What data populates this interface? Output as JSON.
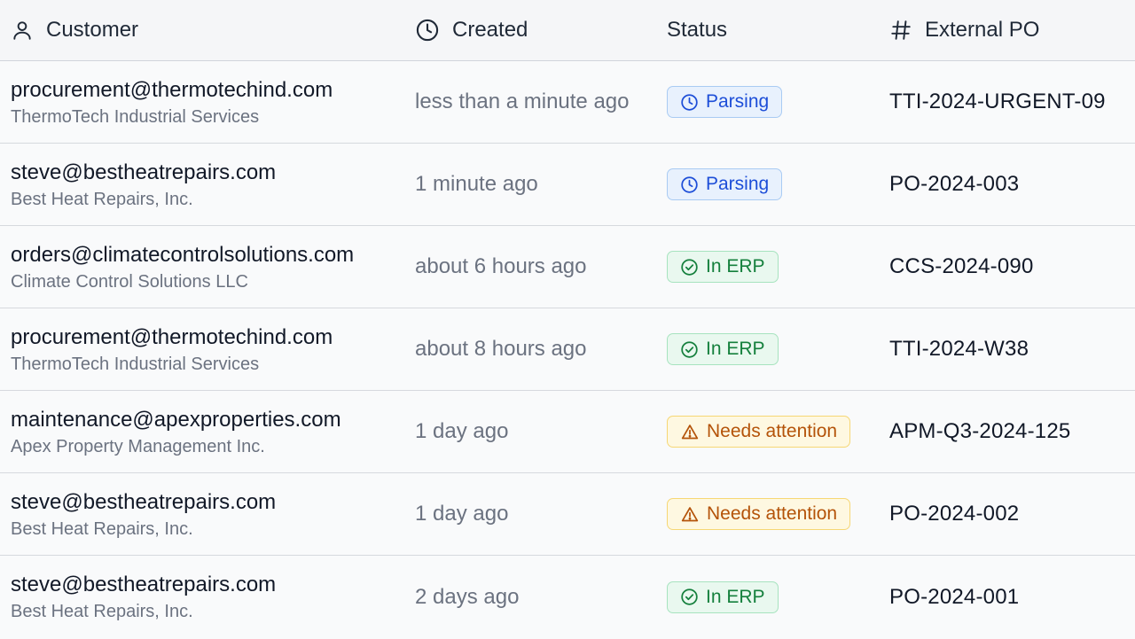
{
  "header": {
    "customer": "Customer",
    "created": "Created",
    "status": "Status",
    "external_po": "External PO"
  },
  "status_colors": {
    "parsing": "#1d4ed8",
    "in_erp": "#15803d",
    "needs_attention": "#b45309"
  },
  "rows": [
    {
      "email": "procurement@thermotechind.com",
      "company": "ThermoTech Industrial Services",
      "created": "less than a minute ago",
      "status": "Parsing",
      "status_type": "parsing",
      "status_icon": "clock-icon",
      "po": "TTI-2024-URGENT-09"
    },
    {
      "email": "steve@bestheatrepairs.com",
      "company": "Best Heat Repairs, Inc.",
      "created": "1 minute ago",
      "status": "Parsing",
      "status_type": "parsing",
      "status_icon": "clock-icon",
      "po": "PO-2024-003"
    },
    {
      "email": "orders@climatecontrolsolutions.com",
      "company": "Climate Control Solutions LLC",
      "created": "about 6 hours ago",
      "status": "In ERP",
      "status_type": "erp",
      "status_icon": "check-circle-icon",
      "po": "CCS-2024-090"
    },
    {
      "email": "procurement@thermotechind.com",
      "company": "ThermoTech Industrial Services",
      "created": "about 8 hours ago",
      "status": "In ERP",
      "status_type": "erp",
      "status_icon": "check-circle-icon",
      "po": "TTI-2024-W38"
    },
    {
      "email": "maintenance@apexproperties.com",
      "company": "Apex Property Management Inc.",
      "created": "1 day ago",
      "status": "Needs attention",
      "status_type": "attn",
      "status_icon": "warning-icon",
      "po": "APM-Q3-2024-125"
    },
    {
      "email": "steve@bestheatrepairs.com",
      "company": "Best Heat Repairs, Inc.",
      "created": "1 day ago",
      "status": "Needs attention",
      "status_type": "attn",
      "status_icon": "warning-icon",
      "po": "PO-2024-002"
    },
    {
      "email": "steve@bestheatrepairs.com",
      "company": "Best Heat Repairs, Inc.",
      "created": "2 days ago",
      "status": "In ERP",
      "status_type": "erp",
      "status_icon": "check-circle-icon",
      "po": "PO-2024-001"
    }
  ]
}
